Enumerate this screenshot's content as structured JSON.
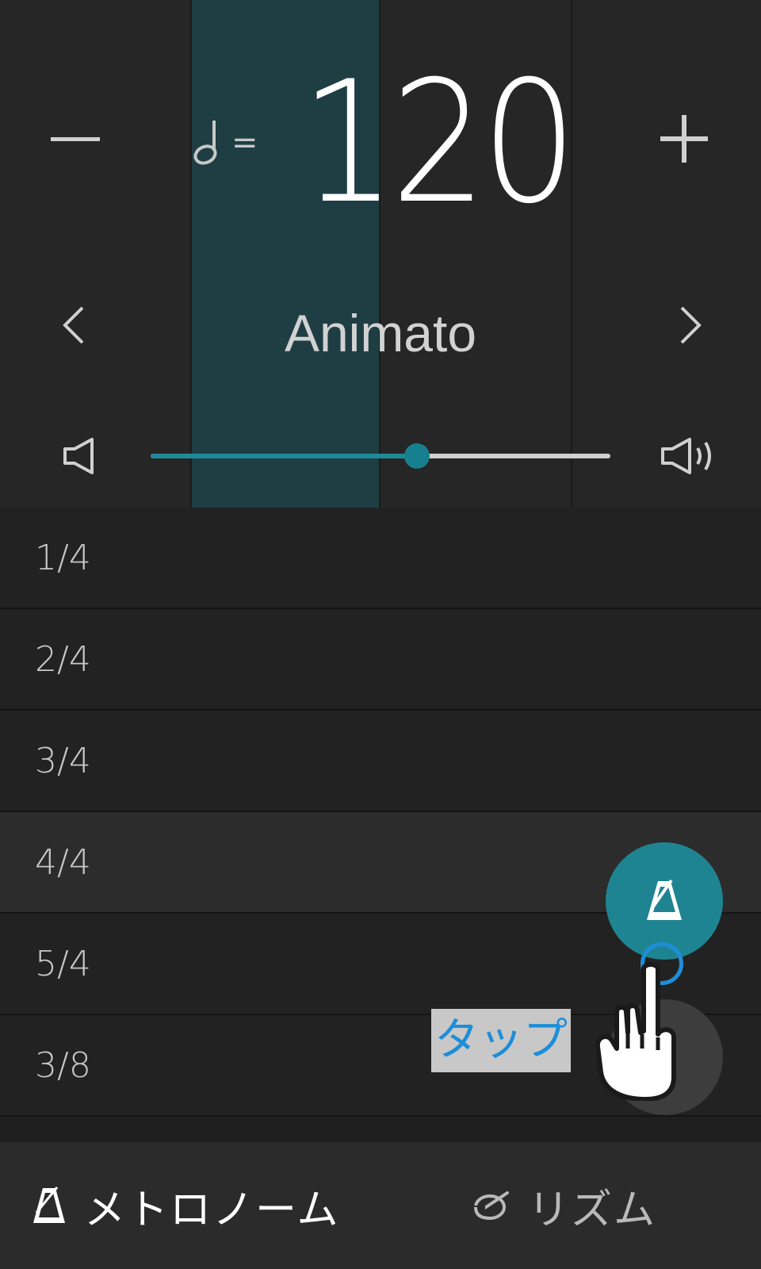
{
  "tempo": {
    "bpm": "120",
    "equals_sign": "=",
    "note_icon": "half-note-icon",
    "name": "Animato"
  },
  "beat_columns": {
    "count": 4,
    "active_index": 1
  },
  "volume": {
    "level": 0.58,
    "low_icon": "speaker-low-icon",
    "high_icon": "speaker-high-icon"
  },
  "time_signatures": {
    "items": [
      "1/4",
      "2/4",
      "3/4",
      "4/4",
      "5/4",
      "3/8"
    ],
    "selected": "4/4"
  },
  "tabs": {
    "metronome": {
      "label": "メトロノーム",
      "icon": "metronome-icon",
      "active": true
    },
    "rhythm": {
      "label": "リズム",
      "icon": "drum-icon",
      "active": false
    }
  },
  "tutorial": {
    "tap_label": "タップ",
    "hand_icon": "pointing-hand-icon"
  },
  "colors": {
    "accent": "#1f8491",
    "active_column": "#1f3e44",
    "tap_blue": "#1d8ed8"
  }
}
